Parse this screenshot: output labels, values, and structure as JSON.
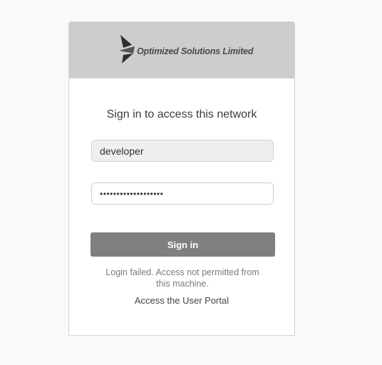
{
  "brand": {
    "logo_icon": "optimized-solutions-logo-mark",
    "name": "Optimized Solutions Limited"
  },
  "login": {
    "heading": "Sign in to access this network",
    "username_value": "developer",
    "password_value": "•••••••••••••••••••",
    "signin_label": "Sign in",
    "error_message": "Login failed. Access not permitted from this machine.",
    "portal_link": "Access the User Portal"
  },
  "colors": {
    "header_bg": "#cdcdcd",
    "button_bg": "#7f7f7f",
    "page_bg": "#f9f9f9"
  }
}
